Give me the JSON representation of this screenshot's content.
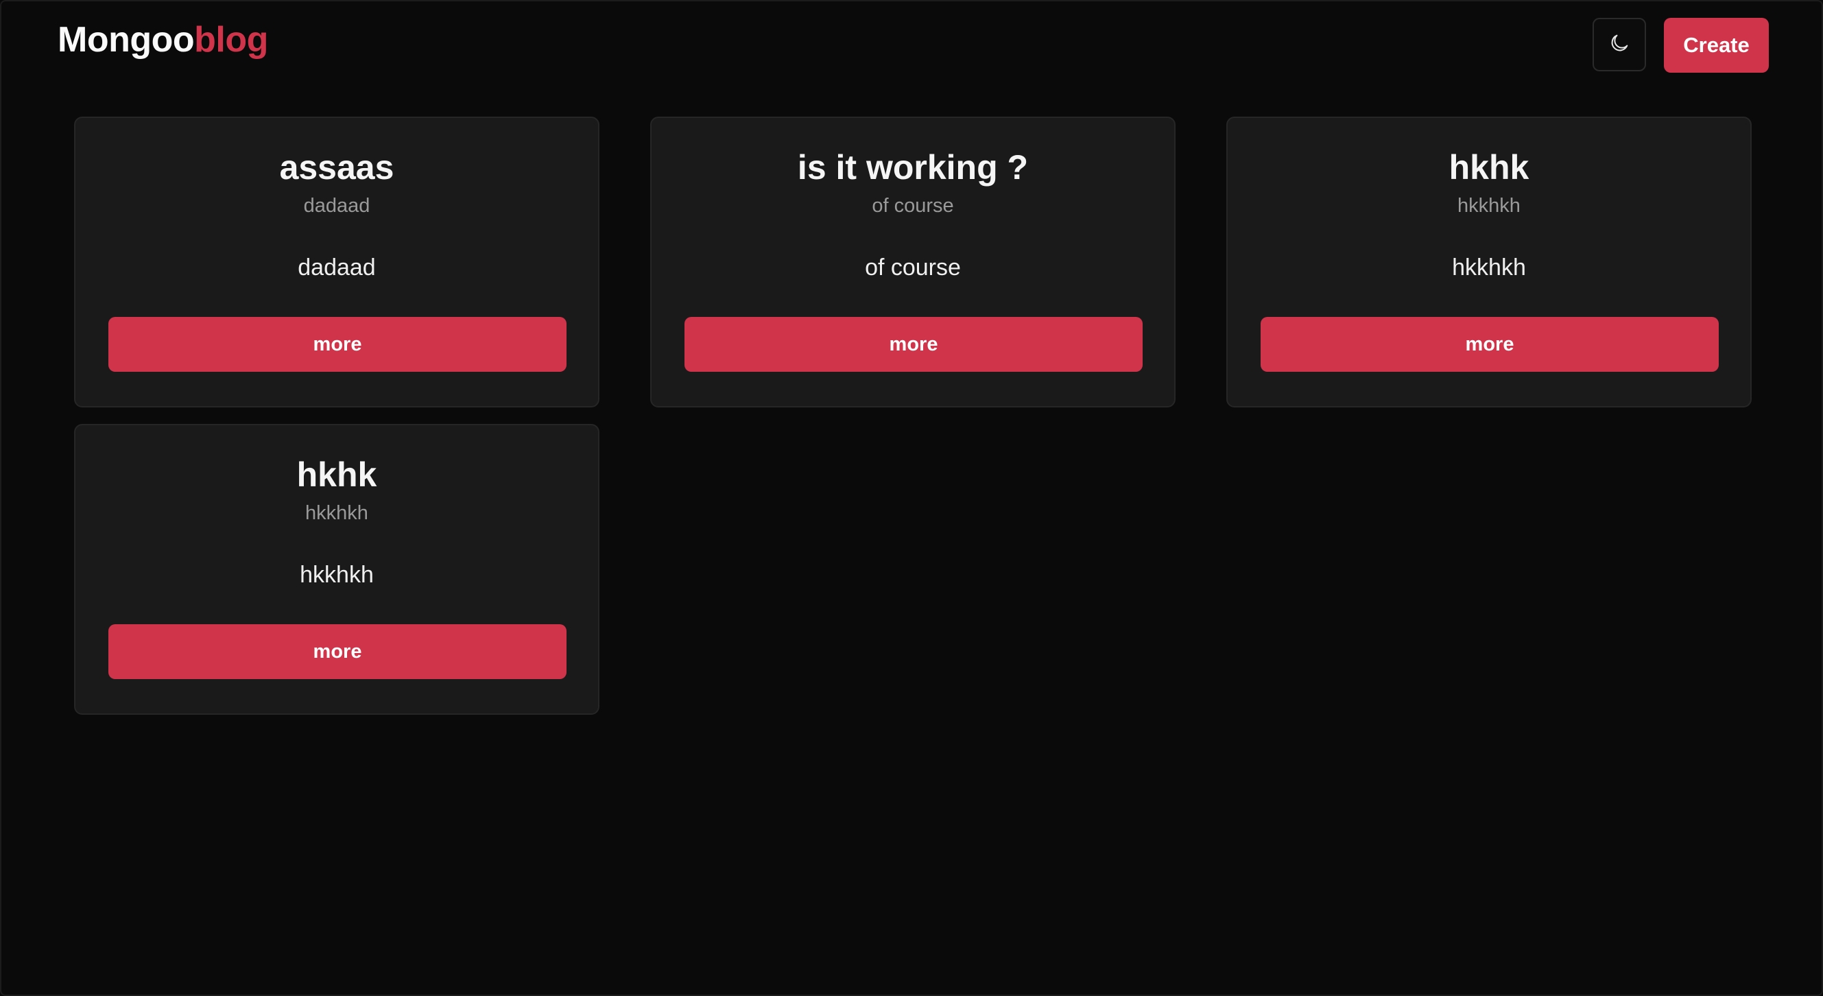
{
  "header": {
    "logo_part1": "Mongoo",
    "logo_part2": "blog",
    "theme_icon": "moon-icon",
    "create_label": "Create"
  },
  "posts": [
    {
      "title": "assaas",
      "subtitle": "dadaad",
      "body": "dadaad",
      "button": "more"
    },
    {
      "title": "is it working ?",
      "subtitle": "of course",
      "body": "of course",
      "button": "more"
    },
    {
      "title": "hkhk",
      "subtitle": "hkkhkh",
      "body": "hkkhkh",
      "button": "more"
    },
    {
      "title": "hkhk",
      "subtitle": "hkkhkh",
      "body": "hkkhkh",
      "button": "more"
    }
  ],
  "colors": {
    "accent": "#d0344b",
    "background": "#0a0a0a",
    "card": "#1a1a1a"
  }
}
